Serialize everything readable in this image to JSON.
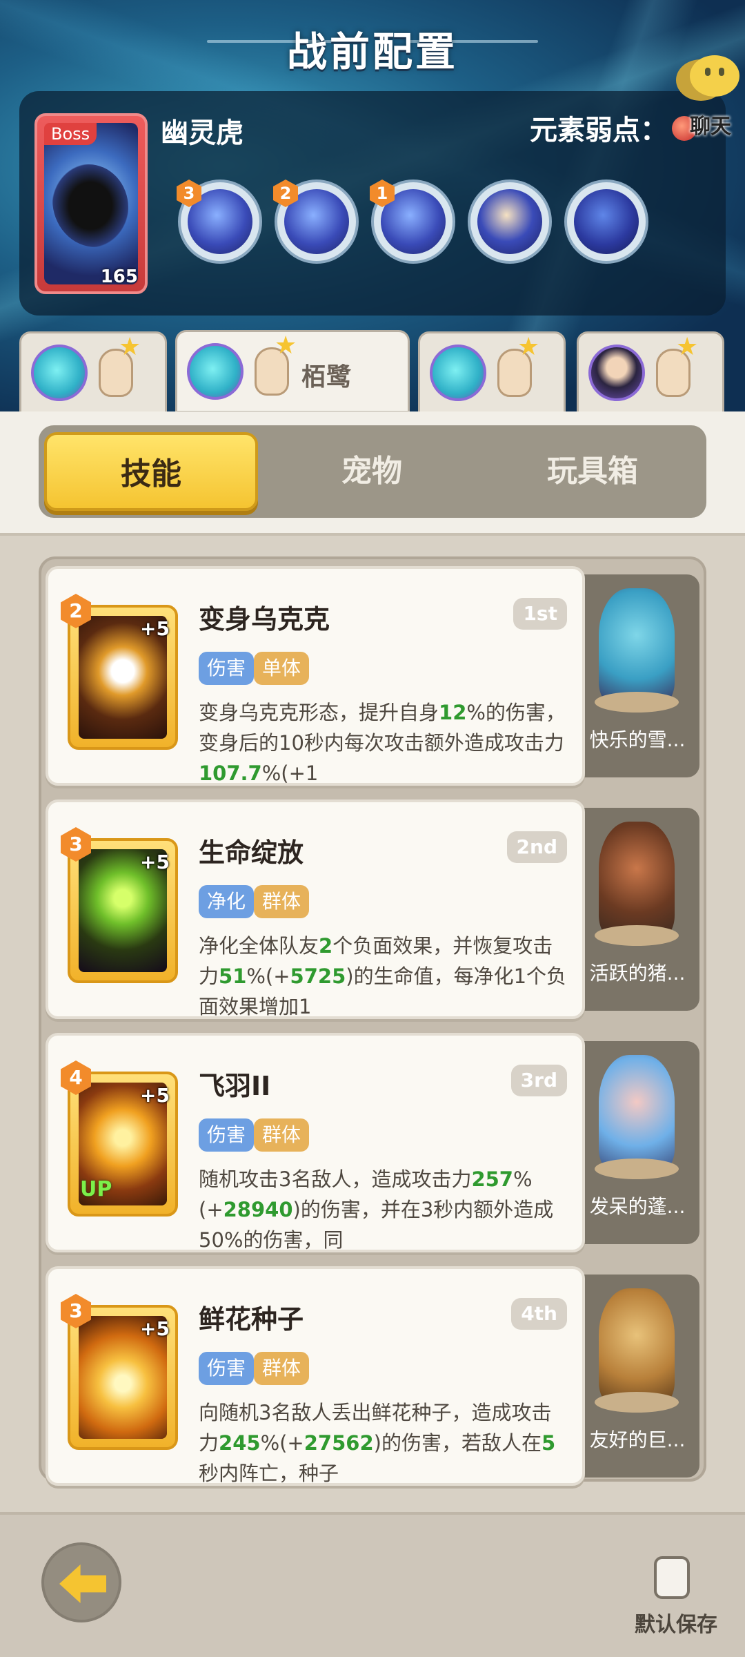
{
  "header": {
    "title": "战前配置"
  },
  "boss": {
    "tag": "Boss",
    "level": "165",
    "name": "幽灵虎",
    "weakness_label": "元素弱点：",
    "skills": [
      {
        "badge": "3",
        "icon": "claw-slash-icon"
      },
      {
        "badge": "2",
        "icon": "ghost-roar-icon"
      },
      {
        "badge": "1",
        "icon": "spirit-face-icon"
      },
      {
        "badge": "",
        "icon": "pounce-icon"
      },
      {
        "badge": "",
        "icon": "shadow-cat-icon"
      }
    ]
  },
  "chat": {
    "label": "聊天"
  },
  "heroes": [
    {
      "name": ""
    },
    {
      "name": "栢鹭"
    },
    {
      "name": ""
    },
    {
      "name": ""
    }
  ],
  "tabs": [
    "技能",
    "宠物",
    "玩具箱"
  ],
  "skills": [
    {
      "title": "变身乌克克",
      "rank": "1st",
      "level": "2",
      "plus": "+5",
      "tags": [
        "伤害",
        "单体"
      ],
      "desc": [
        {
          "t": "变身乌克克形态，提升自身",
          "g": false
        },
        {
          "t": "12",
          "g": true
        },
        {
          "t": "%的伤害，变身后的10秒内每次攻击额外造成攻击力",
          "g": false
        },
        {
          "t": "107.7",
          "g": true
        },
        {
          "t": "%(+1",
          "g": false
        }
      ],
      "pet": "快乐的雪..."
    },
    {
      "title": "生命绽放",
      "rank": "2nd",
      "level": "3",
      "plus": "+5",
      "tags": [
        "净化",
        "群体"
      ],
      "desc": [
        {
          "t": "净化全体队友",
          "g": false
        },
        {
          "t": "2",
          "g": true
        },
        {
          "t": "个负面效果，并恢复攻击力",
          "g": false
        },
        {
          "t": "51",
          "g": true
        },
        {
          "t": "%(+",
          "g": false
        },
        {
          "t": "5725",
          "g": true
        },
        {
          "t": ")的生命值，每净化1个负面效果增加1",
          "g": false
        }
      ],
      "pet": "活跃的猪..."
    },
    {
      "title": "飞羽II",
      "rank": "3rd",
      "level": "4",
      "plus": "+5",
      "up": "UP",
      "tags": [
        "伤害",
        "群体"
      ],
      "desc": [
        {
          "t": "随机攻击3名敌人，造成攻击力",
          "g": false
        },
        {
          "t": "257",
          "g": true
        },
        {
          "t": "%(+",
          "g": false
        },
        {
          "t": "28940",
          "g": true
        },
        {
          "t": ")的伤害，并在3秒内额外造成50%的伤害，同",
          "g": false
        }
      ],
      "pet": "发呆的蓬..."
    },
    {
      "title": "鲜花种子",
      "rank": "4th",
      "level": "3",
      "plus": "+5",
      "tags": [
        "伤害",
        "群体"
      ],
      "desc": [
        {
          "t": "向随机3名敌人丢出鲜花种子，造成攻击力",
          "g": false
        },
        {
          "t": "245",
          "g": true
        },
        {
          "t": "%(+",
          "g": false
        },
        {
          "t": "27562",
          "g": true
        },
        {
          "t": ")的伤害，若敌人在",
          "g": false
        },
        {
          "t": "5",
          "g": true
        },
        {
          "t": "秒内阵亡，种子",
          "g": false
        }
      ],
      "pet": "友好的巨..."
    }
  ],
  "footer": {
    "save_label": "默认保存"
  }
}
